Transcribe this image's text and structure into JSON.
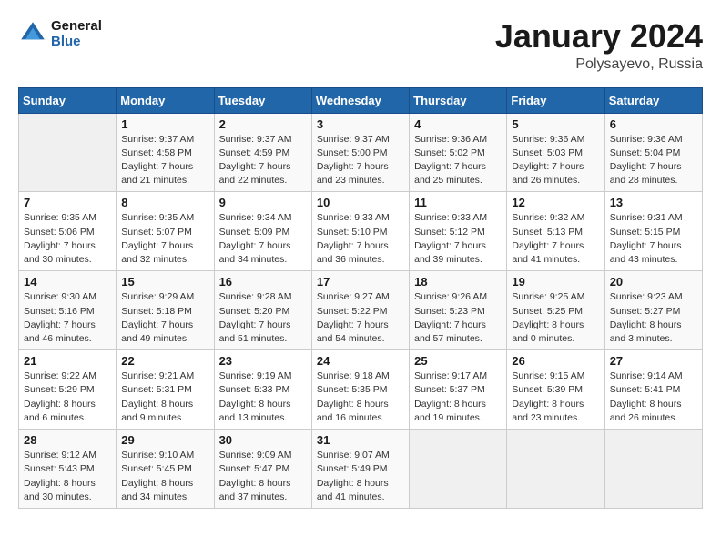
{
  "logo": {
    "general": "General",
    "blue": "Blue"
  },
  "header": {
    "month": "January 2024",
    "location": "Polysayevo, Russia"
  },
  "weekdays": [
    "Sunday",
    "Monday",
    "Tuesday",
    "Wednesday",
    "Thursday",
    "Friday",
    "Saturday"
  ],
  "weeks": [
    [
      {
        "day": "",
        "info": ""
      },
      {
        "day": "1",
        "info": "Sunrise: 9:37 AM\nSunset: 4:58 PM\nDaylight: 7 hours\nand 21 minutes."
      },
      {
        "day": "2",
        "info": "Sunrise: 9:37 AM\nSunset: 4:59 PM\nDaylight: 7 hours\nand 22 minutes."
      },
      {
        "day": "3",
        "info": "Sunrise: 9:37 AM\nSunset: 5:00 PM\nDaylight: 7 hours\nand 23 minutes."
      },
      {
        "day": "4",
        "info": "Sunrise: 9:36 AM\nSunset: 5:02 PM\nDaylight: 7 hours\nand 25 minutes."
      },
      {
        "day": "5",
        "info": "Sunrise: 9:36 AM\nSunset: 5:03 PM\nDaylight: 7 hours\nand 26 minutes."
      },
      {
        "day": "6",
        "info": "Sunrise: 9:36 AM\nSunset: 5:04 PM\nDaylight: 7 hours\nand 28 minutes."
      }
    ],
    [
      {
        "day": "7",
        "info": "Sunrise: 9:35 AM\nSunset: 5:06 PM\nDaylight: 7 hours\nand 30 minutes."
      },
      {
        "day": "8",
        "info": "Sunrise: 9:35 AM\nSunset: 5:07 PM\nDaylight: 7 hours\nand 32 minutes."
      },
      {
        "day": "9",
        "info": "Sunrise: 9:34 AM\nSunset: 5:09 PM\nDaylight: 7 hours\nand 34 minutes."
      },
      {
        "day": "10",
        "info": "Sunrise: 9:33 AM\nSunset: 5:10 PM\nDaylight: 7 hours\nand 36 minutes."
      },
      {
        "day": "11",
        "info": "Sunrise: 9:33 AM\nSunset: 5:12 PM\nDaylight: 7 hours\nand 39 minutes."
      },
      {
        "day": "12",
        "info": "Sunrise: 9:32 AM\nSunset: 5:13 PM\nDaylight: 7 hours\nand 41 minutes."
      },
      {
        "day": "13",
        "info": "Sunrise: 9:31 AM\nSunset: 5:15 PM\nDaylight: 7 hours\nand 43 minutes."
      }
    ],
    [
      {
        "day": "14",
        "info": "Sunrise: 9:30 AM\nSunset: 5:16 PM\nDaylight: 7 hours\nand 46 minutes."
      },
      {
        "day": "15",
        "info": "Sunrise: 9:29 AM\nSunset: 5:18 PM\nDaylight: 7 hours\nand 49 minutes."
      },
      {
        "day": "16",
        "info": "Sunrise: 9:28 AM\nSunset: 5:20 PM\nDaylight: 7 hours\nand 51 minutes."
      },
      {
        "day": "17",
        "info": "Sunrise: 9:27 AM\nSunset: 5:22 PM\nDaylight: 7 hours\nand 54 minutes."
      },
      {
        "day": "18",
        "info": "Sunrise: 9:26 AM\nSunset: 5:23 PM\nDaylight: 7 hours\nand 57 minutes."
      },
      {
        "day": "19",
        "info": "Sunrise: 9:25 AM\nSunset: 5:25 PM\nDaylight: 8 hours\nand 0 minutes."
      },
      {
        "day": "20",
        "info": "Sunrise: 9:23 AM\nSunset: 5:27 PM\nDaylight: 8 hours\nand 3 minutes."
      }
    ],
    [
      {
        "day": "21",
        "info": "Sunrise: 9:22 AM\nSunset: 5:29 PM\nDaylight: 8 hours\nand 6 minutes."
      },
      {
        "day": "22",
        "info": "Sunrise: 9:21 AM\nSunset: 5:31 PM\nDaylight: 8 hours\nand 9 minutes."
      },
      {
        "day": "23",
        "info": "Sunrise: 9:19 AM\nSunset: 5:33 PM\nDaylight: 8 hours\nand 13 minutes."
      },
      {
        "day": "24",
        "info": "Sunrise: 9:18 AM\nSunset: 5:35 PM\nDaylight: 8 hours\nand 16 minutes."
      },
      {
        "day": "25",
        "info": "Sunrise: 9:17 AM\nSunset: 5:37 PM\nDaylight: 8 hours\nand 19 minutes."
      },
      {
        "day": "26",
        "info": "Sunrise: 9:15 AM\nSunset: 5:39 PM\nDaylight: 8 hours\nand 23 minutes."
      },
      {
        "day": "27",
        "info": "Sunrise: 9:14 AM\nSunset: 5:41 PM\nDaylight: 8 hours\nand 26 minutes."
      }
    ],
    [
      {
        "day": "28",
        "info": "Sunrise: 9:12 AM\nSunset: 5:43 PM\nDaylight: 8 hours\nand 30 minutes."
      },
      {
        "day": "29",
        "info": "Sunrise: 9:10 AM\nSunset: 5:45 PM\nDaylight: 8 hours\nand 34 minutes."
      },
      {
        "day": "30",
        "info": "Sunrise: 9:09 AM\nSunset: 5:47 PM\nDaylight: 8 hours\nand 37 minutes."
      },
      {
        "day": "31",
        "info": "Sunrise: 9:07 AM\nSunset: 5:49 PM\nDaylight: 8 hours\nand 41 minutes."
      },
      {
        "day": "",
        "info": ""
      },
      {
        "day": "",
        "info": ""
      },
      {
        "day": "",
        "info": ""
      }
    ]
  ]
}
